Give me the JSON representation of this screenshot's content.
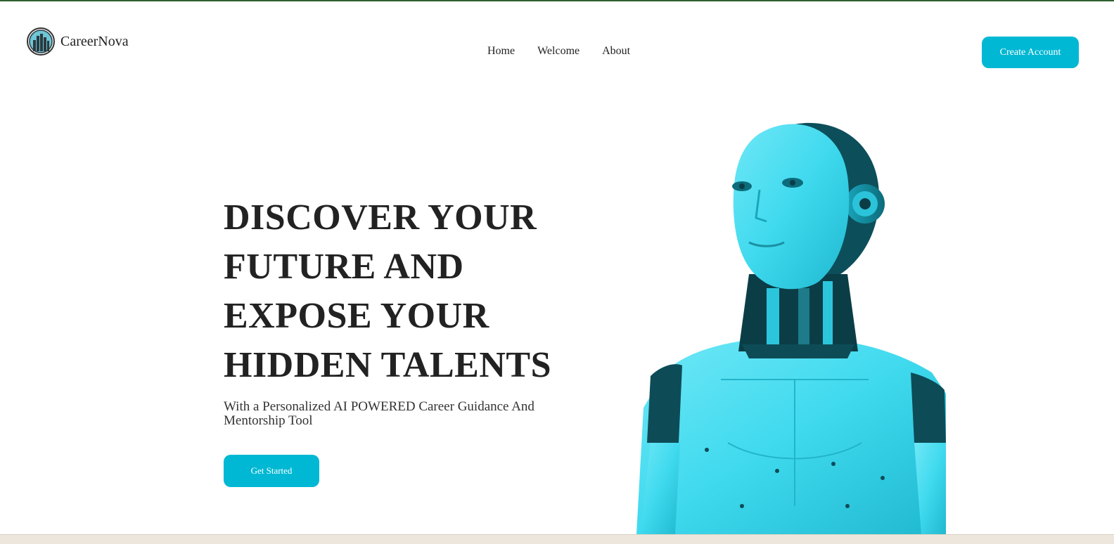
{
  "brand": {
    "name": "CareerNova",
    "logo_icon": "city-skyline-logo-icon"
  },
  "nav": {
    "items": [
      {
        "label": "Home"
      },
      {
        "label": "Welcome"
      },
      {
        "label": "About"
      }
    ],
    "cta_label": "Create Account"
  },
  "hero": {
    "title_lines": [
      "DISCOVER YOUR",
      "FUTURE AND",
      "EXPOSE YOUR",
      "HIDDEN TALENTS"
    ],
    "subtitle": "With a Personalized AI POWERED Career Guidance And Mentorship Tool",
    "cta_label": "Get Started",
    "image": "cyan-humanoid-robot-illustration"
  },
  "colors": {
    "accent": "#00b8d4",
    "robot": "#3fd9ee",
    "text": "#222222",
    "top_rule": "#2f5f2f"
  }
}
